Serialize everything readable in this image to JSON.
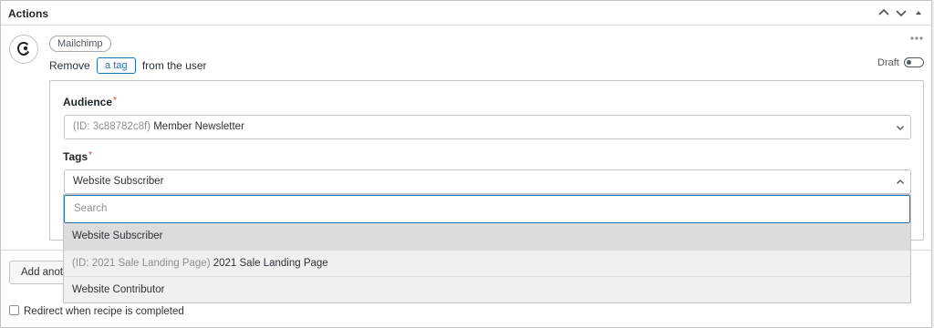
{
  "header": {
    "title": "Actions",
    "controls": [
      "chevron-up",
      "chevron-down",
      "triangle-up"
    ]
  },
  "action": {
    "integration": "Mailchimp",
    "sentence": {
      "before": "Remove",
      "token": "a tag",
      "after": "from the user"
    },
    "status": "Draft",
    "status_toggle_on": false,
    "fields": {
      "audience": {
        "label": "Audience",
        "required_mark": "*",
        "value_id": "(ID: 3c88782c8f)",
        "value": "Member Newsletter"
      },
      "tags": {
        "label": "Tags",
        "required_mark": "*",
        "value": "Website Subscriber",
        "search_placeholder": "Search",
        "options": [
          {
            "id": "",
            "text": "Website Subscriber",
            "selected": true
          },
          {
            "id": "(ID: 2021 Sale Landing Page)",
            "text": "2021 Sale Landing Page",
            "selected": false
          },
          {
            "id": "",
            "text": "Website Contributor",
            "selected": false
          }
        ]
      }
    }
  },
  "footer": {
    "add_button": "Add anoth",
    "redirect_label": "Redirect when recipe is completed",
    "redirect_checked": false
  },
  "colors": {
    "accent": "#2271b1",
    "required": "#d63638",
    "border": "#c3c4c7",
    "option_bg": "#f0f0f1",
    "option_selected_bg": "#dcdcde"
  }
}
